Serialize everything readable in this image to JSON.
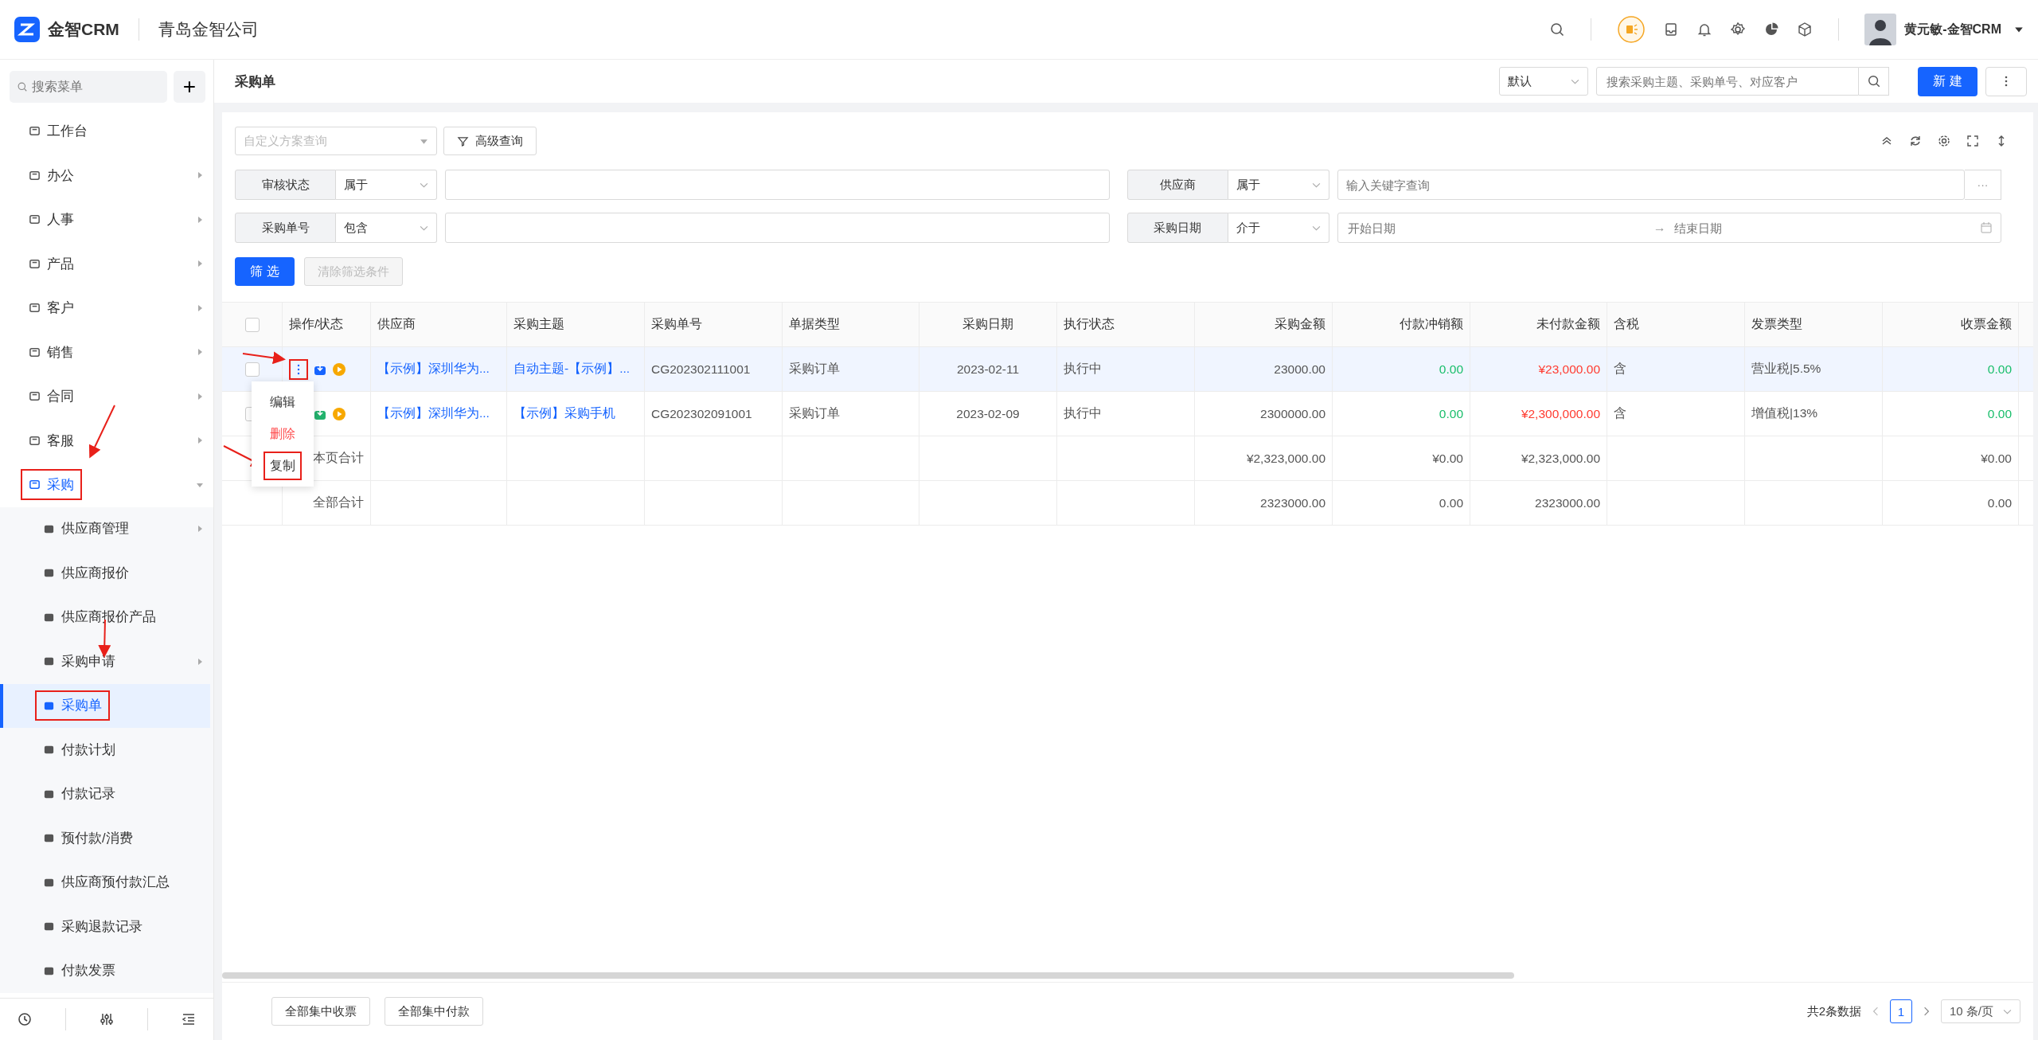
{
  "header": {
    "logo": "金智CRM",
    "company": "青岛金智公司",
    "user": "黄元敏-金智CRM"
  },
  "sidebar": {
    "search_placeholder": "搜索菜单",
    "add_label": "+",
    "items": [
      {
        "label": "工作台",
        "has_children": false,
        "selected": false,
        "highlighted": false
      },
      {
        "label": "办公",
        "has_children": true,
        "expanded": false,
        "selected": false,
        "highlighted": false
      },
      {
        "label": "人事",
        "has_children": true,
        "expanded": false,
        "selected": false,
        "highlighted": false
      },
      {
        "label": "产品",
        "has_children": true,
        "expanded": false,
        "selected": false,
        "highlighted": false
      },
      {
        "label": "客户",
        "has_children": true,
        "expanded": false,
        "selected": false,
        "highlighted": false
      },
      {
        "label": "销售",
        "has_children": true,
        "expanded": false,
        "selected": false,
        "highlighted": false
      },
      {
        "label": "合同",
        "has_children": true,
        "expanded": false,
        "selected": false,
        "highlighted": false
      },
      {
        "label": "客服",
        "has_children": true,
        "expanded": false,
        "selected": false,
        "highlighted": false
      },
      {
        "label": "采购",
        "has_children": true,
        "expanded": true,
        "selected": true,
        "highlighted": true,
        "children": [
          {
            "label": "供应商管理",
            "has_children": true,
            "selected": false,
            "highlighted": false
          },
          {
            "label": "供应商报价",
            "has_children": false,
            "selected": false,
            "highlighted": false
          },
          {
            "label": "供应商报价产品",
            "has_children": false,
            "selected": false,
            "highlighted": false
          },
          {
            "label": "采购申请",
            "has_children": true,
            "selected": false,
            "highlighted": false
          },
          {
            "label": "采购单",
            "has_children": false,
            "selected": true,
            "highlighted": true
          },
          {
            "label": "付款计划",
            "has_children": false,
            "selected": false,
            "highlighted": false
          },
          {
            "label": "付款记录",
            "has_children": false,
            "selected": false,
            "highlighted": false
          },
          {
            "label": "预付款/消费",
            "has_children": false,
            "selected": false,
            "highlighted": false
          },
          {
            "label": "供应商预付款汇总",
            "has_children": false,
            "selected": false,
            "highlighted": false
          },
          {
            "label": "采购退款记录",
            "has_children": false,
            "selected": false,
            "highlighted": false
          },
          {
            "label": "付款发票",
            "has_children": false,
            "selected": false,
            "highlighted": false
          }
        ]
      }
    ]
  },
  "toolbar": {
    "title": "采购单",
    "view": "默认",
    "search_placeholder": "搜索采购主题、采购单号、对应客户",
    "new_button": "新 建"
  },
  "filters": {
    "scheme_placeholder": "自定义方案查询",
    "advanced_button": "高级查询",
    "fields": [
      {
        "kind": "text",
        "label": "审核状态",
        "operator": "属于"
      },
      {
        "kind": "keyword",
        "label": "供应商",
        "operator": "属于",
        "placeholder": "输入关键字查询",
        "more": "···"
      },
      {
        "kind": "text",
        "label": "采购单号",
        "operator": "包含"
      },
      {
        "kind": "daterange",
        "label": "采购日期",
        "operator": "介于",
        "start_placeholder": "开始日期",
        "separator": "→",
        "end_placeholder": "结束日期"
      }
    ],
    "apply_button": "筛 选",
    "clear_button": {
      "label": "清除筛选条件",
      "disabled": true
    }
  },
  "table": {
    "header_checked": false,
    "action_column": "操作/状态",
    "columns": [
      "供应商",
      "采购主题",
      "采购单号",
      "单据类型",
      "采购日期",
      "执行状态",
      "采购金额",
      "付款冲销额",
      "未付款金额",
      "含税",
      "发票类型",
      "收票金额"
    ],
    "rows": [
      {
        "kind": "data",
        "selected": true,
        "checked": false,
        "menu_open": true,
        "color": "#1664ff",
        "cells": [
          {
            "text": "【示例】深圳华为...",
            "color": "#1664ff"
          },
          {
            "text": "自动主题-【示例】...",
            "color": "#1664ff"
          },
          {
            "text": "CG202302111001",
            "color": "#555555"
          },
          {
            "text": "采购订单",
            "color": "#555555"
          },
          {
            "text": "2023-02-11",
            "color": "#555555"
          },
          {
            "text": "执行中",
            "color": "#555555"
          },
          {
            "text": "23000.00",
            "color": "#555555"
          },
          {
            "text": "0.00",
            "color": "#19be6b"
          },
          {
            "text": "¥23,000.00",
            "color": "#ff3b30"
          },
          {
            "text": "含",
            "color": "#555555"
          },
          {
            "text": "营业税|5.5%",
            "color": "#555555"
          },
          {
            "text": "0.00",
            "color": "#19be6b"
          }
        ]
      },
      {
        "kind": "data",
        "selected": false,
        "checked": false,
        "menu_open": false,
        "color": "#23b26d",
        "cells": [
          {
            "text": "【示例】深圳华为...",
            "color": "#1664ff"
          },
          {
            "text": "【示例】采购手机",
            "color": "#1664ff"
          },
          {
            "text": "CG202302091001",
            "color": "#555555"
          },
          {
            "text": "采购订单",
            "color": "#555555"
          },
          {
            "text": "2023-02-09",
            "color": "#555555"
          },
          {
            "text": "执行中",
            "color": "#555555"
          },
          {
            "text": "2300000.00",
            "color": "#555555"
          },
          {
            "text": "0.00",
            "color": "#19be6b"
          },
          {
            "text": "¥2,300,000.00",
            "color": "#ff3b30"
          },
          {
            "text": "含",
            "color": "#555555"
          },
          {
            "text": "增值税|13%",
            "color": "#555555"
          },
          {
            "text": "0.00",
            "color": "#19be6b"
          }
        ]
      },
      {
        "kind": "total",
        "label": "本页合计",
        "cells": [
          null,
          null,
          null,
          null,
          null,
          null,
          {
            "text": "¥2,323,000.00",
            "color": "#555555"
          },
          {
            "text": "¥0.00",
            "color": "#555555"
          },
          {
            "text": "¥2,323,000.00",
            "color": "#555555"
          },
          null,
          null,
          {
            "text": "¥0.00",
            "color": "#555555"
          }
        ]
      },
      {
        "kind": "total",
        "label": "全部合计",
        "cells": [
          null,
          null,
          null,
          null,
          null,
          null,
          {
            "text": "2323000.00",
            "color": "#555555"
          },
          {
            "text": "0.00",
            "color": "#555555"
          },
          {
            "text": "2323000.00",
            "color": "#555555"
          },
          null,
          null,
          {
            "text": "0.00",
            "color": "#555555"
          }
        ]
      }
    ],
    "row_menu": [
      {
        "label": "编辑",
        "kind": "normal",
        "highlighted": false
      },
      {
        "label": "删除",
        "kind": "danger",
        "highlighted": false
      },
      {
        "label": "复制",
        "kind": "normal",
        "highlighted": true
      }
    ]
  },
  "footer": {
    "buttons": [
      "全部集中收票",
      "全部集中付款"
    ],
    "total": "共2条数据",
    "page": "1",
    "page_size": "10 条/页"
  }
}
